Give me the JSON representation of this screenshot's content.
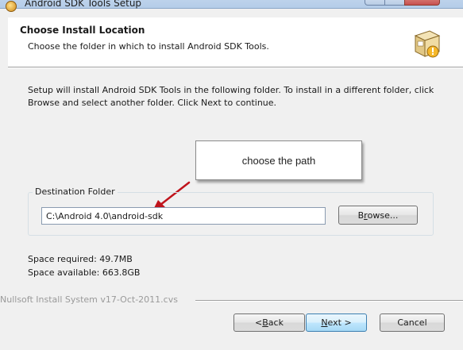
{
  "window": {
    "title": "Android SDK Tools Setup"
  },
  "header": {
    "title": "Choose Install Location",
    "subtitle": "Choose the folder in which to install Android SDK Tools."
  },
  "intro": {
    "line1": "Setup will install Android SDK Tools in the following folder. To install in a different folder, click",
    "line2": "Browse and select another folder. Click Next to continue."
  },
  "annotation": {
    "callout_text": "choose the path",
    "arrow_color": "#c0141c"
  },
  "destination": {
    "group_label": "Destination Folder",
    "path_value": "C:\\Android 4.0\\android-sdk",
    "browse_label_pre": "B",
    "browse_label_u": "r",
    "browse_label_post": "owse..."
  },
  "space": {
    "required": "Space required: 49.7MB",
    "available": "Space available: 663.8GB"
  },
  "footer": {
    "branding": "Nullsoft Install System v17-Oct-2011.cvs",
    "back_prefix": "< ",
    "back_u": "B",
    "back_rest": "ack",
    "next_u": "N",
    "next_rest": "ext >",
    "cancel_label": "Cancel"
  }
}
